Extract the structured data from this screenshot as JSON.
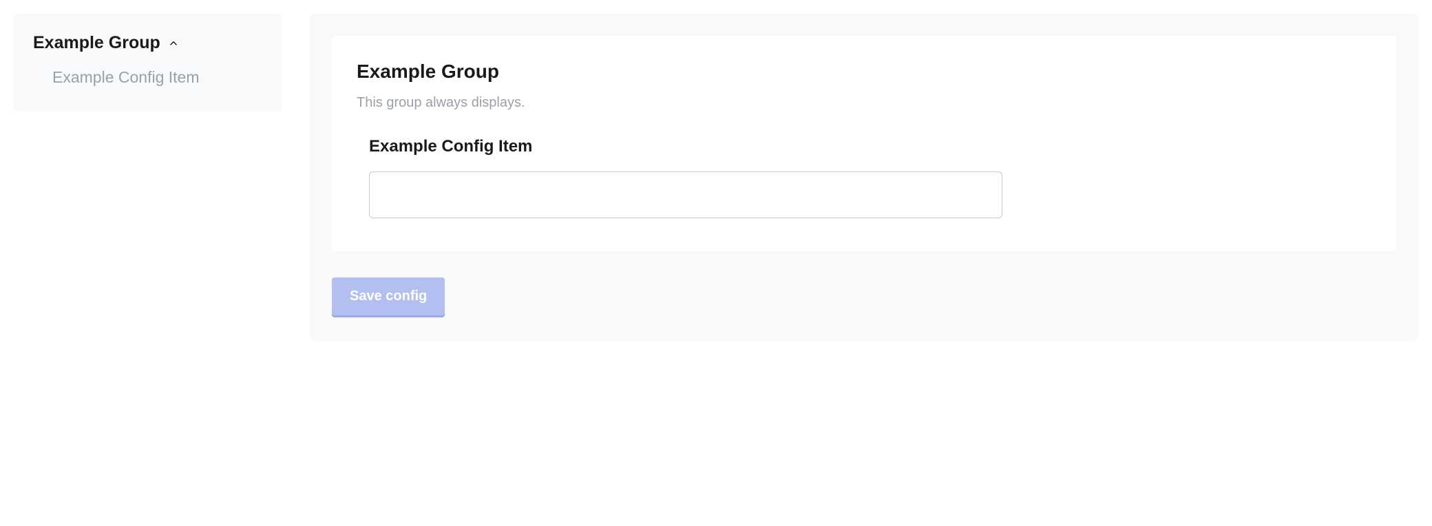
{
  "sidebar": {
    "group_title": "Example Group",
    "items": [
      {
        "label": "Example Config Item"
      }
    ]
  },
  "main": {
    "group_title": "Example Group",
    "group_description": "This group always displays.",
    "config_items": [
      {
        "label": "Example Config Item",
        "value": ""
      }
    ],
    "save_label": "Save config"
  }
}
